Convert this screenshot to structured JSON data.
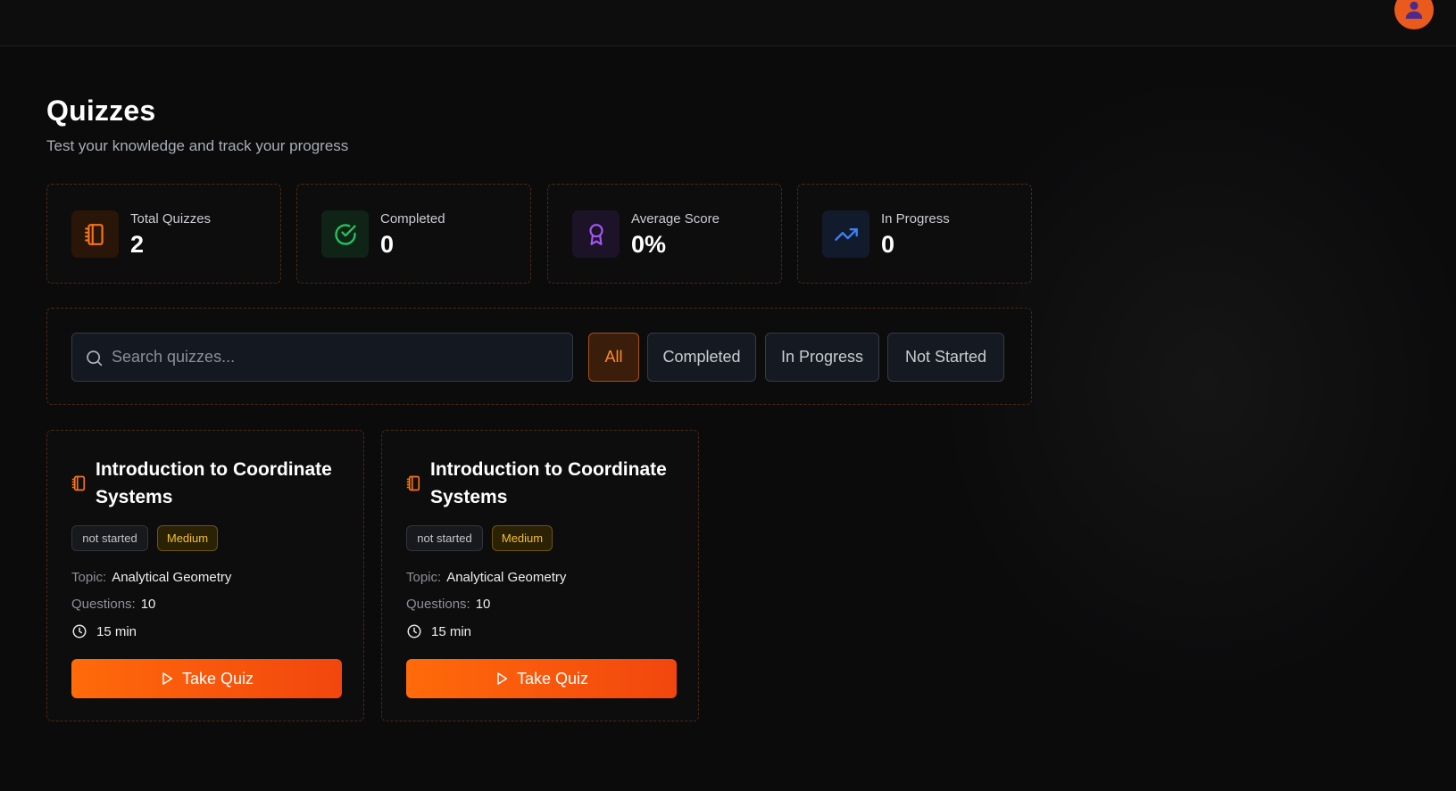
{
  "header": {
    "avatar_icon": "user-icon"
  },
  "page": {
    "title": "Quizzes",
    "subtitle": "Test your knowledge and track your progress"
  },
  "stats": [
    {
      "label": "Total Quizzes",
      "value": "2",
      "icon": "notebook-icon",
      "color": "#f97316"
    },
    {
      "label": "Completed",
      "value": "0",
      "icon": "check-circle-icon",
      "color": "#22c55e"
    },
    {
      "label": "Average Score",
      "value": "0%",
      "icon": "award-icon",
      "color": "#a855f7"
    },
    {
      "label": "In Progress",
      "value": "0",
      "icon": "trending-up-icon",
      "color": "#3b82f6"
    }
  ],
  "filters": {
    "search_placeholder": "Search quizzes...",
    "search_value": "",
    "options": [
      "All",
      "Completed",
      "In Progress",
      "Not Started"
    ],
    "selected": "All"
  },
  "quizzes": [
    {
      "title": "Introduction to Coordinate Systems",
      "status": "not started",
      "difficulty": "Medium",
      "topic_label": "Topic:",
      "topic": "Analytical Geometry",
      "questions_label": "Questions:",
      "questions": "10",
      "duration": "15 min",
      "action_label": "Take Quiz"
    },
    {
      "title": "Introduction to Coordinate Systems",
      "status": "not started",
      "difficulty": "Medium",
      "topic_label": "Topic:",
      "topic": "Analytical Geometry",
      "questions_label": "Questions:",
      "questions": "10",
      "duration": "15 min",
      "action_label": "Take Quiz"
    }
  ],
  "colors": {
    "accent": "#f97316",
    "background": "#0b0b0c",
    "badge_medium": "#f5c12b"
  }
}
